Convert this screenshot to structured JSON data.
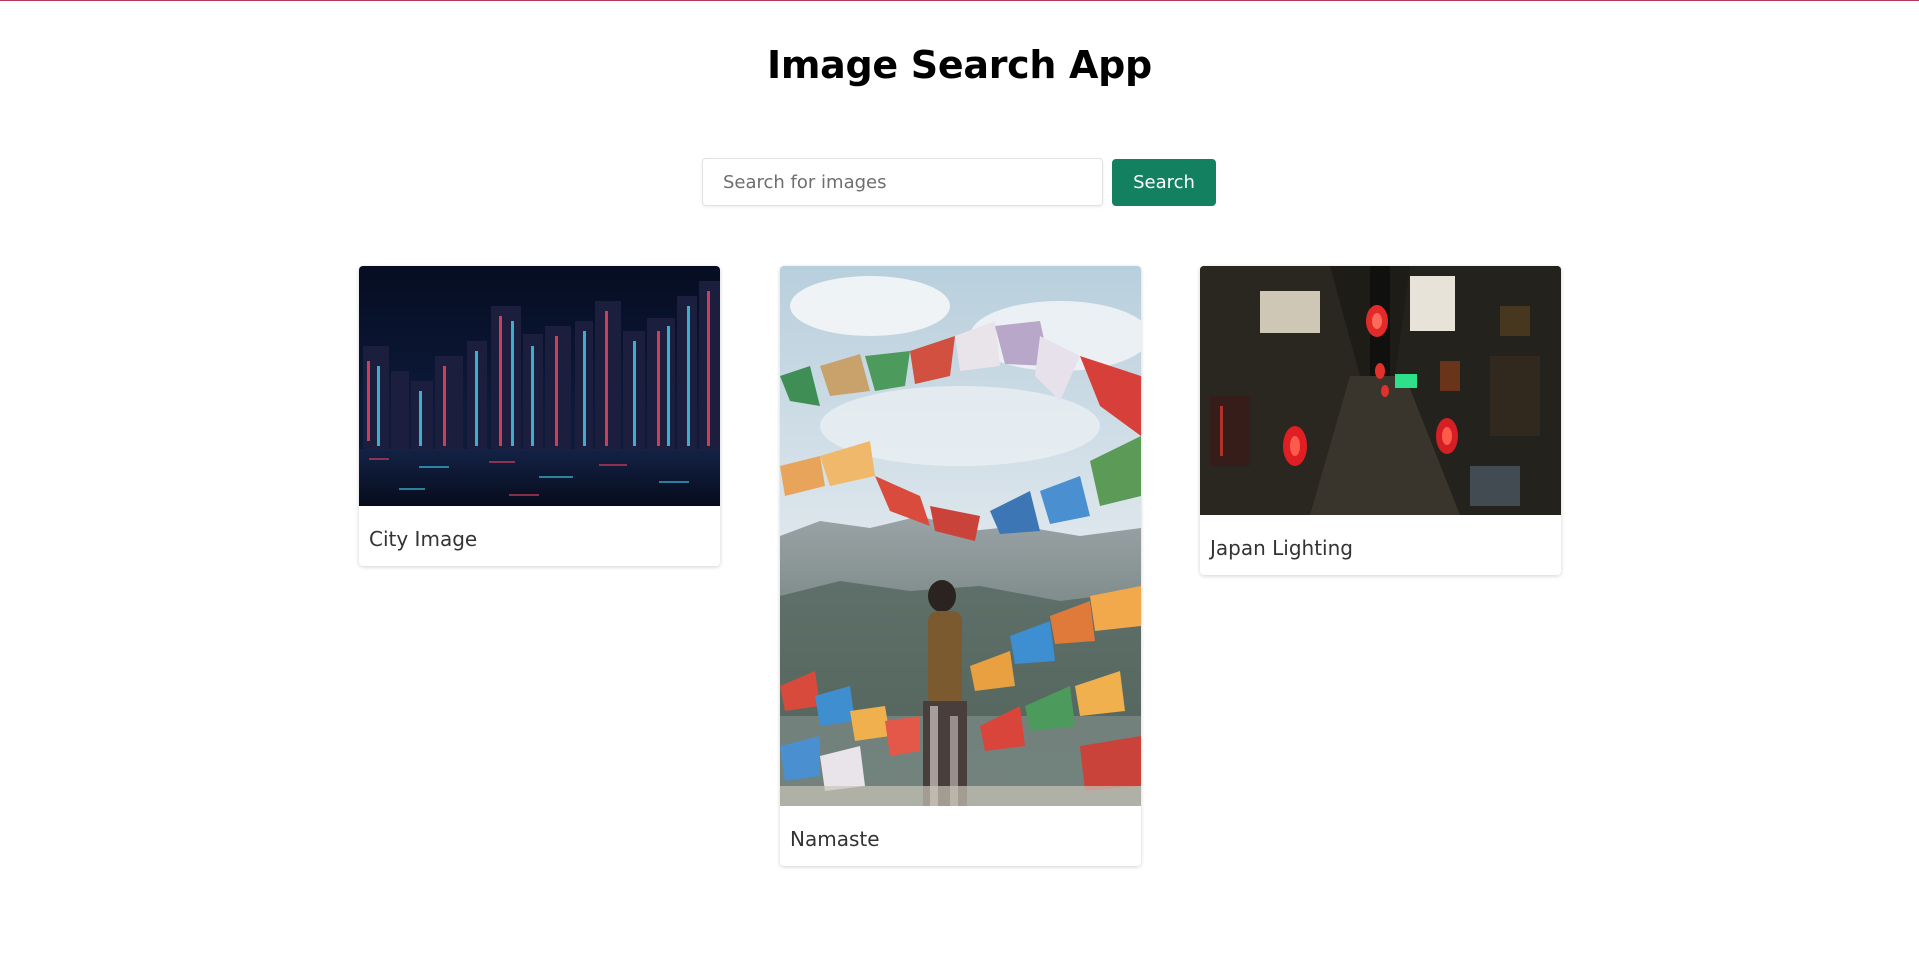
{
  "header": {
    "title": "Image Search App"
  },
  "search": {
    "placeholder": "Search for images",
    "value": "",
    "button_label": "Search"
  },
  "results": [
    {
      "caption": "City Image",
      "image_subject": "night-city-skyline-photo"
    },
    {
      "caption": "Namaste",
      "image_subject": "prayer-flags-mountain-photo"
    },
    {
      "caption": "Japan Lighting",
      "image_subject": "japanese-alley-lanterns-photo"
    }
  ],
  "colors": {
    "accent": "#13815f",
    "top_border": "#b33a5c"
  }
}
